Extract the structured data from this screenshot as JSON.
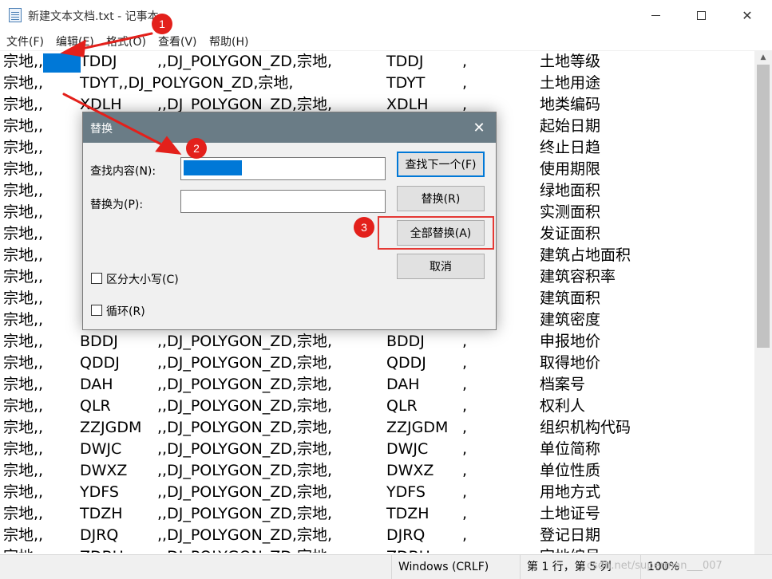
{
  "window": {
    "title": "新建文本文档.txt - 记事本"
  },
  "menu": {
    "file": "文件(F)",
    "edit": "编辑(E)",
    "format": "格式(O)",
    "view": "查看(V)",
    "help": "帮助(H)"
  },
  "editor_lines": [
    [
      "宗地,,",
      "TDDJ",
      ",,DJ_POLYGON_ZD,宗地,",
      "TDDJ",
      ",",
      "土地等级"
    ],
    [
      "宗地,,",
      "TDYT,,DJ_POLYGON_ZD,宗地,",
      "",
      "TDYT",
      ",",
      "土地用途"
    ],
    [
      "宗地,,",
      "XDLH",
      ",,DJ_POLYGON_ZD,宗地,",
      "XDLH",
      ",",
      "地类编码"
    ],
    [
      "宗地,,",
      "",
      "",
      "",
      "",
      "起始日期"
    ],
    [
      "宗地,,",
      "",
      "",
      "",
      "",
      "终止日趋"
    ],
    [
      "宗地,,",
      "",
      "",
      "",
      "",
      "使用期限"
    ],
    [
      "宗地,,",
      "",
      "",
      "",
      "",
      "绿地面积"
    ],
    [
      "宗地,,",
      "",
      "",
      "",
      "",
      "实测面积"
    ],
    [
      "宗地,,",
      "",
      "",
      "",
      "",
      "发证面积"
    ],
    [
      "宗地,,",
      "",
      "",
      "",
      "",
      "建筑占地面积"
    ],
    [
      "宗地,,",
      "",
      "",
      "",
      "",
      "建筑容积率"
    ],
    [
      "宗地,,",
      "",
      "",
      "",
      "",
      "建筑面积"
    ],
    [
      "宗地,,",
      "",
      "",
      "",
      "",
      "建筑密度"
    ],
    [
      "宗地,,",
      "BDDJ",
      ",,DJ_POLYGON_ZD,宗地,",
      "BDDJ",
      ",",
      "申报地价"
    ],
    [
      "宗地,,",
      "QDDJ",
      ",,DJ_POLYGON_ZD,宗地,",
      "QDDJ",
      ",",
      "取得地价"
    ],
    [
      "宗地,,",
      "DAH",
      ",,DJ_POLYGON_ZD,宗地,",
      "DAH",
      ",",
      "档案号"
    ],
    [
      "宗地,,",
      "QLR",
      ",,DJ_POLYGON_ZD,宗地,",
      "QLR",
      ",",
      "权利人"
    ],
    [
      "宗地,,",
      "ZZJGDM",
      ",,DJ_POLYGON_ZD,宗地,",
      "ZZJGDM",
      ",",
      "组织机构代码"
    ],
    [
      "宗地,,",
      "DWJC",
      ",,DJ_POLYGON_ZD,宗地,",
      "DWJC",
      ",",
      "单位简称"
    ],
    [
      "宗地,,",
      "DWXZ",
      ",,DJ_POLYGON_ZD,宗地,",
      "DWXZ",
      ",",
      "单位性质"
    ],
    [
      "宗地,,",
      "YDFS",
      ",,DJ_POLYGON_ZD,宗地,",
      "YDFS",
      ",",
      "用地方式"
    ],
    [
      "宗地,,",
      "TDZH",
      ",,DJ_POLYGON_ZD,宗地,",
      "TDZH",
      ",",
      "土地证号"
    ],
    [
      "宗地,,",
      "DJRQ",
      ",,DJ_POLYGON_ZD,宗地,",
      "DJRQ",
      ",",
      "登记日期"
    ],
    [
      "宗地,,",
      "ZDBH",
      ",,DJ_POLYGON_ZD,宗地,",
      "ZDBH",
      ",",
      "宗地编号"
    ]
  ],
  "dialog": {
    "title": "替换",
    "find_label": "查找内容(N):",
    "replace_label": "替换为(P):",
    "find_next": "查找下一个(F)",
    "replace": "替换(R)",
    "replace_all": "全部替换(A)",
    "cancel": "取消",
    "match_case": "区分大小写(C)",
    "wrap": "循环(R)"
  },
  "status": {
    "encoding": "Windows (CRLF)",
    "position": "第 1 行，第 5 列",
    "zoom": "100%",
    "watermark": "csdn.net/superman___007"
  },
  "annotations": {
    "badges": [
      "1",
      "2",
      "3"
    ],
    "color": "#e3201b"
  },
  "colors": {
    "selection": "#0078d7",
    "dialog_title_bg": "#6a7c86",
    "highlight_box": "#e53935"
  }
}
